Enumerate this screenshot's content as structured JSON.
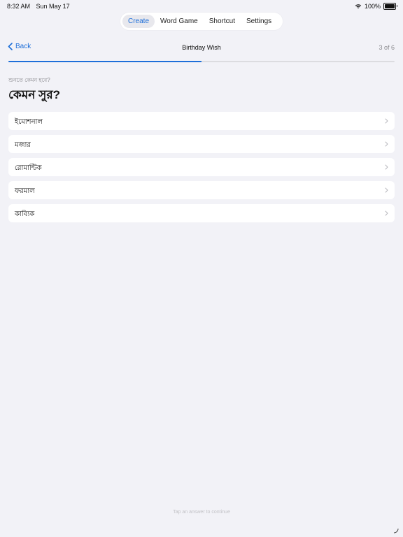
{
  "status_bar": {
    "time": "8:32 AM",
    "date": "Sun May 17",
    "battery": "100%",
    "battery_level": 1.0
  },
  "tabs": [
    {
      "label": "Create",
      "active": true
    },
    {
      "label": "Word Game",
      "active": false
    },
    {
      "label": "Shortcut",
      "active": false
    },
    {
      "label": "Settings",
      "active": false
    }
  ],
  "nav": {
    "back_label": "Back",
    "title": "Birthday Wish",
    "step": "3 of 6"
  },
  "progress": {
    "fraction": 0.5
  },
  "question": {
    "subtitle": "শুনতে কেমন হবে?",
    "title": "কেমন সুর?"
  },
  "options": [
    {
      "label": "ইমোশনাল"
    },
    {
      "label": "মজার"
    },
    {
      "label": "রোমান্টিক"
    },
    {
      "label": "ফরমাল"
    },
    {
      "label": "কাব্যিক"
    }
  ],
  "hint": "Tap an answer to continue",
  "colors": {
    "accent": "#1e6fd9",
    "background": "#f2f2f7",
    "card": "#ffffff"
  }
}
